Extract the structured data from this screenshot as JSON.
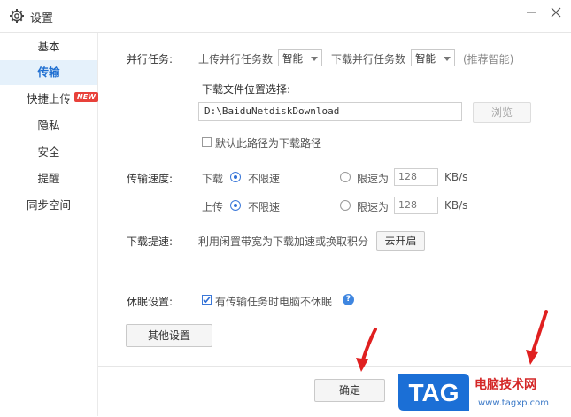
{
  "window": {
    "title": "设置"
  },
  "sidebar": {
    "items": [
      {
        "label": "基本"
      },
      {
        "label": "传输"
      },
      {
        "label": "快捷上传"
      },
      {
        "label": "隐私"
      },
      {
        "label": "安全"
      },
      {
        "label": "提醒"
      },
      {
        "label": "同步空间"
      }
    ],
    "new_badge": "NEW"
  },
  "parallel": {
    "label": "并行任务:",
    "upload_label": "上传并行任务数",
    "upload_value": "智能",
    "download_label": "下载并行任务数",
    "download_value": "智能",
    "hint": "(推荐智能)"
  },
  "download_path": {
    "label": "下载文件位置选择:",
    "value": "D:\\BaiduNetdiskDownload",
    "browse": "浏览",
    "default_checkbox": "默认此路径为下载路径"
  },
  "speed": {
    "label": "传输速度:",
    "download_label": "下载",
    "upload_label": "上传",
    "unlimited": "不限速",
    "limit": "限速为",
    "download_limit_value": "128",
    "upload_limit_value": "128",
    "unit": "KB/s"
  },
  "boost": {
    "label": "下载提速:",
    "text": "利用闲置带宽为下载加速或换取积分",
    "button": "去开启"
  },
  "sleep": {
    "label": "休眠设置:",
    "checkbox": "有传输任务时电脑不休眠"
  },
  "other_settings": "其他设置",
  "confirm": "确定",
  "watermark": {
    "logo": "TAG",
    "title": "电脑技术网",
    "url": "www.tagxp.com"
  },
  "colors": {
    "accent": "#1f6fd1",
    "badge": "#e8413a",
    "arrow": "#e02020",
    "logo": "#1b6fd6"
  }
}
